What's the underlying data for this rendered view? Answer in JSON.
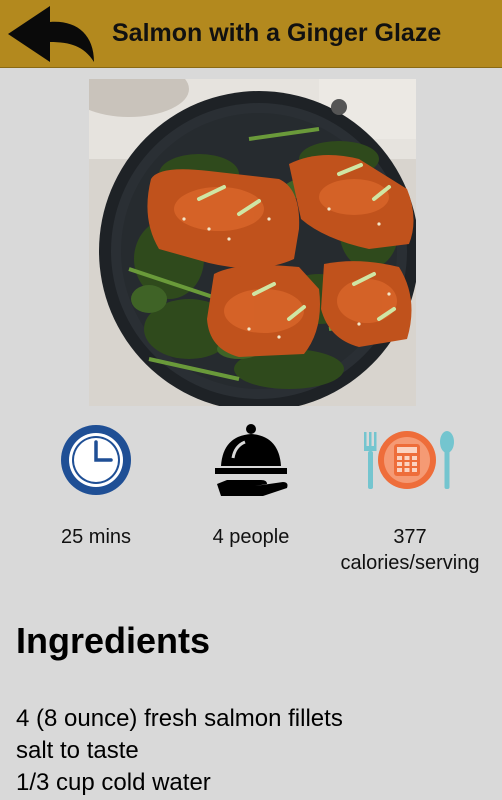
{
  "header": {
    "title": "Salmon with a Ginger Glaze"
  },
  "stats": {
    "time": "25 mins",
    "servings": "4 people",
    "calories_value": "377",
    "calories_unit": "calories/serving"
  },
  "icons": {
    "back": "back-arrow-icon",
    "clock": "clock-icon",
    "servings": "serving-cloche-icon",
    "calories": "calculator-plate-icon"
  },
  "ingredients": {
    "title": "Ingredients",
    "items": [
      "4 (8 ounce) fresh salmon fillets",
      "salt to taste",
      "1/3 cup cold water"
    ]
  },
  "colors": {
    "header_bg": "#b3891e",
    "page_bg": "#d9d9d9",
    "clock_blue": "#1f4f95",
    "calc_orange": "#ee6d3a",
    "cutlery_teal": "#74c5cf"
  }
}
